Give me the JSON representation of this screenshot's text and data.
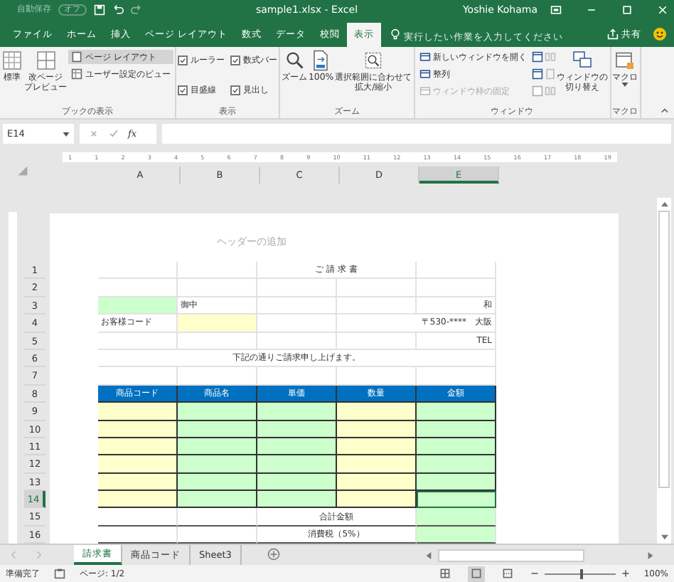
{
  "title_bar": {
    "autosave_label": "自動保存",
    "autosave_state": "オフ",
    "autosave": false,
    "title": "sample1.xlsx  -  Excel",
    "user": "Yoshie Kohama"
  },
  "ribbon_tabs": [
    {
      "label": "ファイル",
      "selected": false
    },
    {
      "label": "ホーム",
      "selected": false
    },
    {
      "label": "挿入",
      "selected": false
    },
    {
      "label": "ページ レイアウト",
      "selected": false
    },
    {
      "label": "数式",
      "selected": false
    },
    {
      "label": "データ",
      "selected": false
    },
    {
      "label": "校閲",
      "selected": false
    },
    {
      "label": "表示",
      "selected": true
    }
  ],
  "tell_me": {
    "placeholder": "実行したい作業を入力してください"
  },
  "share": "共有",
  "ribbon": {
    "book_view": {
      "label": "ブックの表示",
      "normal": [
        "標準"
      ],
      "page_break": [
        "改ページ",
        "プレビュー"
      ],
      "page_layout": {
        "label": "ページ レイアウト",
        "selected": true
      },
      "custom_views": "ユーザー設定のビュー"
    },
    "show": {
      "label": "表示",
      "checks": [
        {
          "label": "ルーラー",
          "checked": true
        },
        {
          "label": "数式バー",
          "checked": true
        },
        {
          "label": "目盛線",
          "checked": true
        },
        {
          "label": "見出し",
          "checked": true
        }
      ]
    },
    "zoom": {
      "label": "ズーム",
      "buttons": [
        [
          "ズーム"
        ],
        [
          "100%"
        ],
        [
          "選択範囲に合わせて",
          "拡大/縮小"
        ]
      ]
    },
    "window": {
      "label": "ウィンドウ",
      "items": [
        {
          "label": "新しいウィンドウを開く",
          "disabled": false
        },
        {
          "label": "整列",
          "disabled": false
        },
        {
          "label": "ウィンドウ枠の固定",
          "disabled": true
        }
      ],
      "switch": [
        "ウィンドウの",
        "切り替え"
      ]
    },
    "macro": {
      "label": "マクロ",
      "button": [
        "マクロ"
      ]
    }
  },
  "formula_bar": {
    "name_box": "E14",
    "function_button": "fx"
  },
  "columns": [
    {
      "label": "A",
      "selected": false
    },
    {
      "label": "B",
      "selected": false
    },
    {
      "label": "C",
      "selected": false
    },
    {
      "label": "D",
      "selected": false
    },
    {
      "label": "E",
      "selected": true
    }
  ],
  "ruler": [
    "1",
    "1",
    "2",
    "3",
    "4",
    "5",
    "6",
    "7",
    "8",
    "9",
    "10",
    "11",
    "12",
    "13",
    "14",
    "15",
    "16",
    "17",
    "18",
    "19"
  ],
  "header_placeholder": "ヘッダーの追加",
  "rows": [
    {
      "number": "1",
      "selected": false,
      "cells": [
        {},
        {},
        {
          "text": "ご 請 求 書",
          "merged": true
        },
        {}
      ]
    },
    {
      "number": "2",
      "selected": false,
      "cells": [
        {},
        {},
        {},
        {},
        {}
      ]
    },
    {
      "number": "3",
      "selected": false,
      "cells": [
        {
          "color": "#ccffcc"
        },
        {
          "text": "御中"
        },
        {},
        {},
        {
          "text": "和"
        }
      ]
    },
    {
      "number": "4",
      "selected": false,
      "cells": [
        {
          "text": "お客様コード"
        },
        {
          "color": "#ffffcc"
        },
        {},
        {
          "text": "〒530-****　大阪",
          "merged": true
        }
      ]
    },
    {
      "number": "5",
      "selected": false,
      "cells": [
        {},
        {},
        {},
        {},
        {
          "text": "TEL"
        }
      ]
    },
    {
      "number": "6",
      "selected": false,
      "cells": [
        {
          "text": "下記の通りご請求申し上げます。",
          "merged": true
        }
      ]
    },
    {
      "number": "7",
      "selected": false,
      "cells": [
        {},
        {},
        {},
        {},
        {}
      ]
    },
    {
      "number": "8",
      "selected": false,
      "kind": "header",
      "cells": [
        {
          "text": "商品コード",
          "color": "#0070c0"
        },
        {
          "text": "商品名",
          "color": "#0070c0"
        },
        {
          "text": "単価",
          "color": "#0070c0"
        },
        {
          "text": "数量",
          "color": "#0070c0"
        },
        {
          "text": "金額",
          "color": "#0070c0"
        }
      ]
    },
    {
      "number": "9",
      "selected": false,
      "kind": "item",
      "cells": [
        {
          "color": "#ffffcc"
        },
        {
          "color": "#ccffcc"
        },
        {
          "color": "#ccffcc"
        },
        {
          "color": "#ffffcc"
        },
        {
          "color": "#ccffcc"
        }
      ]
    },
    {
      "number": "10",
      "selected": false,
      "kind": "item",
      "cells": [
        {
          "color": "#ffffcc"
        },
        {
          "color": "#ccffcc"
        },
        {
          "color": "#ccffcc"
        },
        {
          "color": "#ffffcc"
        },
        {
          "color": "#ccffcc"
        }
      ]
    },
    {
      "number": "11",
      "selected": false,
      "kind": "item",
      "cells": [
        {
          "color": "#ffffcc"
        },
        {
          "color": "#ccffcc"
        },
        {
          "color": "#ccffcc"
        },
        {
          "color": "#ffffcc"
        },
        {
          "color": "#ccffcc"
        }
      ]
    },
    {
      "number": "12",
      "selected": false,
      "kind": "item",
      "cells": [
        {
          "color": "#ffffcc"
        },
        {
          "color": "#ccffcc"
        },
        {
          "color": "#ccffcc"
        },
        {
          "color": "#ffffcc"
        },
        {
          "color": "#ccffcc"
        }
      ]
    },
    {
      "number": "13",
      "selected": false,
      "kind": "item",
      "cells": [
        {
          "color": "#ffffcc"
        },
        {
          "color": "#ccffcc"
        },
        {
          "color": "#ccffcc"
        },
        {
          "color": "#ffffcc"
        },
        {
          "color": "#ccffcc"
        }
      ]
    },
    {
      "number": "14",
      "selected": true,
      "kind": "item",
      "cells": [
        {
          "color": "#ffffcc"
        },
        {
          "color": "#ccffcc"
        },
        {
          "color": "#ccffcc"
        },
        {
          "color": "#ffffcc"
        },
        {
          "color": "#ccffcc",
          "selected": true
        }
      ]
    },
    {
      "number": "15",
      "selected": false,
      "kind": "total",
      "cells": [
        {},
        {},
        {
          "text": "合計金額",
          "merged": true
        },
        {
          "color": "#ccffcc"
        }
      ]
    },
    {
      "number": "16",
      "selected": false,
      "kind": "total",
      "cells": [
        {},
        {},
        {
          "text": "消費税（5%）",
          "merged": true
        },
        {
          "color": "#ccffcc"
        }
      ]
    }
  ],
  "sheet_tabs": [
    {
      "label": "請求書",
      "selected": true
    },
    {
      "label": "商品コード",
      "selected": false
    },
    {
      "label": "Sheet3",
      "selected": false
    }
  ],
  "status_bar": {
    "status": "準備完了",
    "page": "ページ: 1/2",
    "view_buttons": [
      {
        "selected": false
      },
      {
        "selected": true
      },
      {
        "selected": false
      }
    ],
    "zoom": "100%",
    "level": 0.5
  }
}
